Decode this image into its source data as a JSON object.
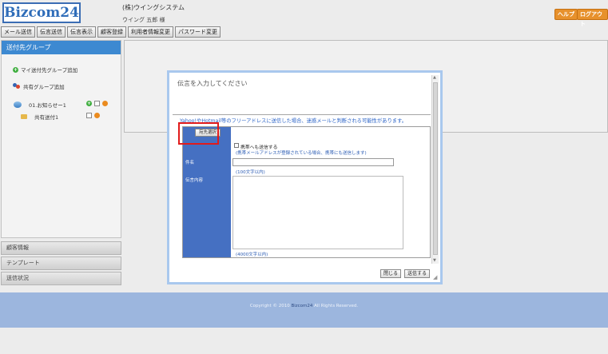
{
  "header": {
    "logo": "Bizcom24",
    "company": "(株)ウイングシステム",
    "user": "ウイング 五郎 様",
    "help_label": "ヘルプ",
    "logout_label": "ログアウト"
  },
  "nav": {
    "items": [
      "メール送信",
      "伝言送信",
      "伝言表示",
      "顧客登録",
      "利用者情報変更",
      "パスワード変更"
    ]
  },
  "sidebar": {
    "header": "送付先グループ",
    "my_group": "マイ送付先グループ追加",
    "shared_group": "共有グループ追加",
    "item1": "01.お知らせー1",
    "item2": "共有送付1",
    "accordions": [
      "顧客情報",
      "テンプレート",
      "送信状況"
    ]
  },
  "modal": {
    "title": "伝言を入力してください",
    "warning": "Yahoo!やHotmail等のフリーアドレスに送信した場合、迷惑メールと判断される可能性があります。",
    "select_button": "宛先選択",
    "subject_label": "件名",
    "body_label": "伝言内容",
    "mobile_checkbox_label": "携帯へも送信する",
    "mobile_note": "(携帯メールアドレスが登録されている場合、携帯にも送信します)",
    "subject_limit": "(100文字以内)",
    "body_limit": "(4000文字以内)",
    "close_button": "閉じる",
    "send_button": "送信する"
  },
  "footer": {
    "copyright_prefix": "Copyright © 2010",
    "brand": "Bizcom24",
    "copyright_suffix": "All Rights Reserved."
  }
}
